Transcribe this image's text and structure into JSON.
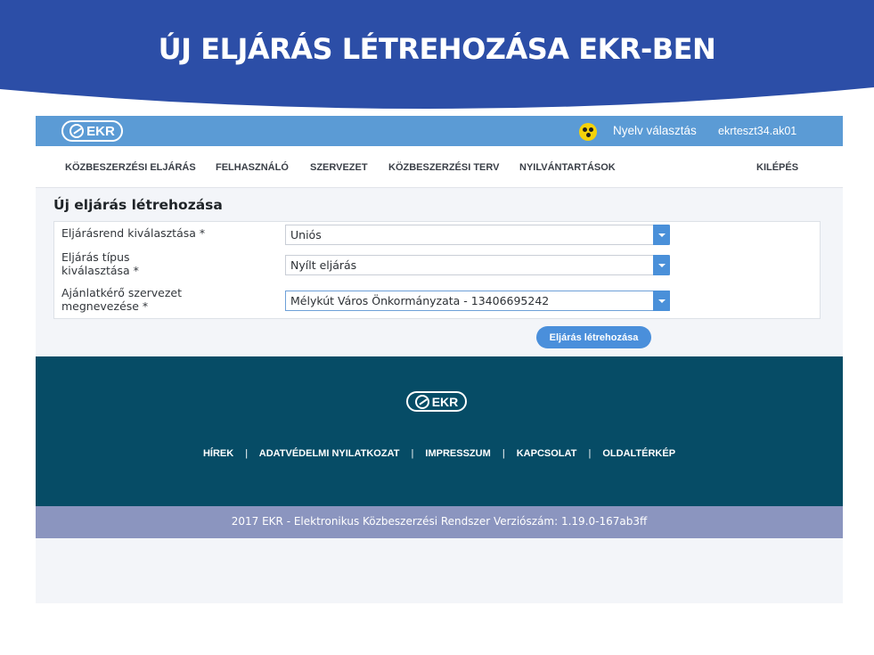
{
  "slide": {
    "title": "ÚJ ELJÁRÁS LÉTREHOZÁSA EKR-BEN",
    "banner_color": "#2c4ea7"
  },
  "app": {
    "logo_text": "EKR",
    "topbar_color": "#5b9bd5",
    "language_label": "Nyelv választás",
    "user": "ekrteszt34.ak01"
  },
  "nav": {
    "items": [
      "KÖZBESZERZÉSI ELJÁRÁS",
      "FELHASZNÁLÓ",
      "SZERVEZET",
      "KÖZBESZERZÉSI TERV",
      "NYILVÁNTARTÁSOK"
    ],
    "logout": "KILÉPÉS"
  },
  "page": {
    "title": "Új eljárás létrehozása"
  },
  "form": {
    "fields": [
      {
        "label": "Eljárásrend kiválasztása  *",
        "value": "Uniós"
      },
      {
        "label": "Eljárás típus kiválasztása  *",
        "value": "Nyílt eljárás"
      },
      {
        "label": "Ajánlatkérő szervezet megnevezése  *",
        "value": "Mélykút Város Önkormányzata - 13406695242"
      }
    ],
    "submit_label": "Eljárás létrehozása",
    "accent_color": "#4a8fdb"
  },
  "footer": {
    "logo_text": "EKR",
    "links": [
      "HÍREK",
      "ADATVÉDELMI NYILATKOZAT",
      "IMPRESSZUM",
      "KAPCSOLAT",
      "OLDALTÉRKÉP"
    ],
    "separator": "|",
    "background_color": "#064c66",
    "copyright": "2017 EKR - Elektronikus Közbeszerzési Rendszer Verziószám: 1.19.0-167ab3ff",
    "copyright_bar_color": "#8b95bf"
  }
}
